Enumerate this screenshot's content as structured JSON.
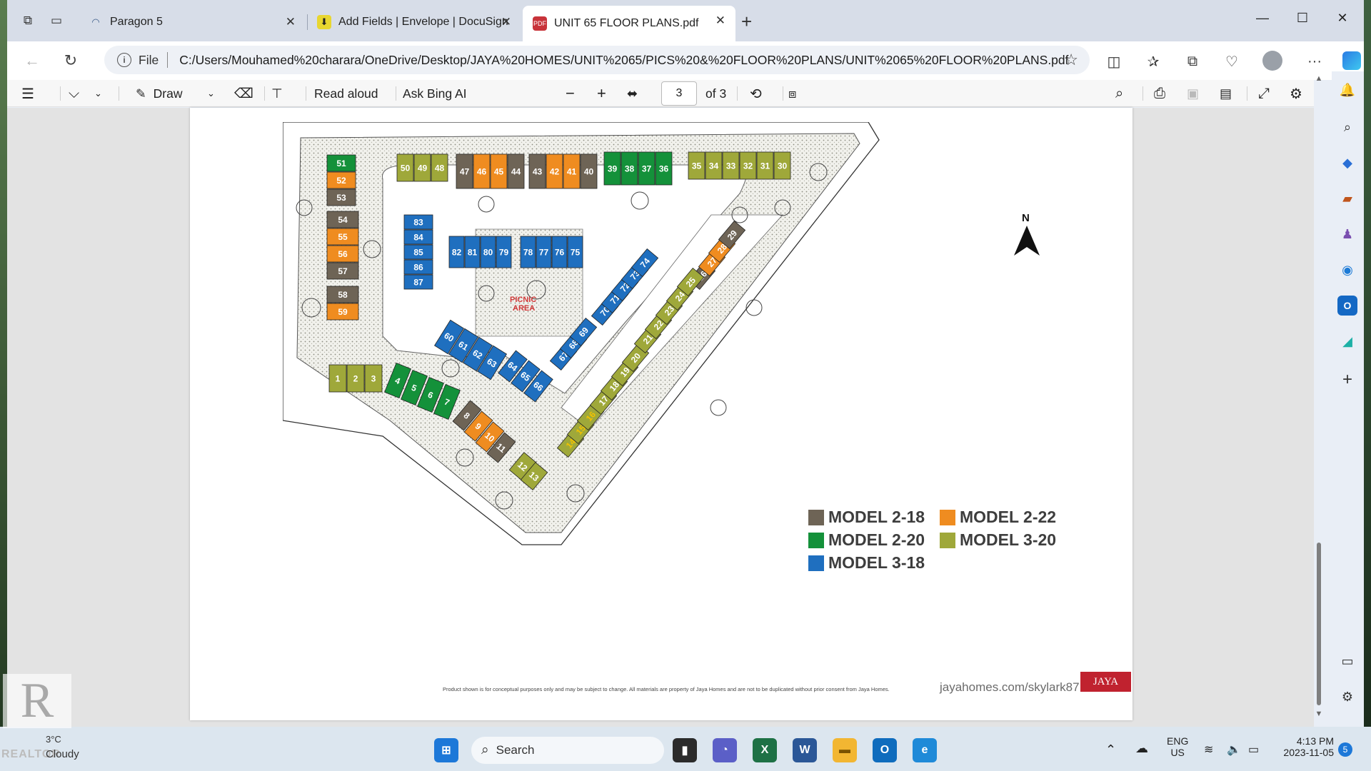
{
  "tabs": [
    {
      "title": "Paragon 5"
    },
    {
      "title": "Add Fields | Envelope | DocuSign"
    },
    {
      "title": "UNIT 65 FLOOR PLANS.pdf"
    }
  ],
  "address": {
    "scheme": "File",
    "url": "C:/Users/Mouhamed%20charara/OneDrive/Desktop/JAYA%20HOMES/UNIT%2065/PICS%20&%20FLOOR%20PLANS/UNIT%2065%20FLOOR%20PLANS.pdf"
  },
  "pdf_toolbar": {
    "draw_label": "Draw",
    "read_aloud_label": "Read aloud",
    "ask_bing_label": "Ask Bing AI",
    "page_current": "3",
    "page_total": "of 3"
  },
  "plan": {
    "picnic_label_1": "PICNIC",
    "picnic_label_2": "AREA",
    "north_label": "N",
    "colors": {
      "model_2_18": "#6e6456",
      "model_2_22": "#ef8c20",
      "model_2_20": "#14913a",
      "model_3_20": "#9fa83a",
      "model_3_18": "#1f6fbf"
    },
    "units": [
      {
        "n": "1",
        "m": "model_3_20"
      },
      {
        "n": "2",
        "m": "model_3_20"
      },
      {
        "n": "3",
        "m": "model_3_20"
      },
      {
        "n": "4",
        "m": "model_2_20"
      },
      {
        "n": "5",
        "m": "model_2_20"
      },
      {
        "n": "6",
        "m": "model_2_20"
      },
      {
        "n": "7",
        "m": "model_2_20"
      },
      {
        "n": "8",
        "m": "model_2_18"
      },
      {
        "n": "9",
        "m": "model_2_22"
      },
      {
        "n": "10",
        "m": "model_2_22"
      },
      {
        "n": "11",
        "m": "model_2_18"
      },
      {
        "n": "12",
        "m": "model_3_20"
      },
      {
        "n": "13",
        "m": "model_3_20"
      },
      {
        "n": "14",
        "m": "model_3_20"
      },
      {
        "n": "15",
        "m": "model_3_20"
      },
      {
        "n": "16",
        "m": "model_3_20"
      },
      {
        "n": "17",
        "m": "model_3_20"
      },
      {
        "n": "18",
        "m": "model_3_20"
      },
      {
        "n": "19",
        "m": "model_3_20"
      },
      {
        "n": "20",
        "m": "model_3_20"
      },
      {
        "n": "21",
        "m": "model_3_20"
      },
      {
        "n": "22",
        "m": "model_3_20"
      },
      {
        "n": "23",
        "m": "model_3_20"
      },
      {
        "n": "24",
        "m": "model_3_20"
      },
      {
        "n": "25",
        "m": "model_3_20"
      },
      {
        "n": "26",
        "m": "model_2_18"
      },
      {
        "n": "27",
        "m": "model_2_22"
      },
      {
        "n": "28",
        "m": "model_2_22"
      },
      {
        "n": "29",
        "m": "model_2_18"
      },
      {
        "n": "30",
        "m": "model_3_20"
      },
      {
        "n": "31",
        "m": "model_3_20"
      },
      {
        "n": "32",
        "m": "model_3_20"
      },
      {
        "n": "33",
        "m": "model_3_20"
      },
      {
        "n": "34",
        "m": "model_3_20"
      },
      {
        "n": "35",
        "m": "model_3_20"
      },
      {
        "n": "36",
        "m": "model_2_20"
      },
      {
        "n": "37",
        "m": "model_2_20"
      },
      {
        "n": "38",
        "m": "model_2_20"
      },
      {
        "n": "39",
        "m": "model_2_20"
      },
      {
        "n": "40",
        "m": "model_2_18"
      },
      {
        "n": "41",
        "m": "model_2_22"
      },
      {
        "n": "42",
        "m": "model_2_22"
      },
      {
        "n": "43",
        "m": "model_2_18"
      },
      {
        "n": "44",
        "m": "model_2_18"
      },
      {
        "n": "45",
        "m": "model_2_22"
      },
      {
        "n": "46",
        "m": "model_2_22"
      },
      {
        "n": "47",
        "m": "model_2_18"
      },
      {
        "n": "48",
        "m": "model_3_20"
      },
      {
        "n": "49",
        "m": "model_3_20"
      },
      {
        "n": "50",
        "m": "model_3_20"
      },
      {
        "n": "51",
        "m": "model_2_20"
      },
      {
        "n": "52",
        "m": "model_2_22"
      },
      {
        "n": "53",
        "m": "model_2_18"
      },
      {
        "n": "54",
        "m": "model_2_18"
      },
      {
        "n": "55",
        "m": "model_2_22"
      },
      {
        "n": "56",
        "m": "model_2_22"
      },
      {
        "n": "57",
        "m": "model_2_18"
      },
      {
        "n": "58",
        "m": "model_2_18"
      },
      {
        "n": "59",
        "m": "model_2_22"
      },
      {
        "n": "60",
        "m": "model_3_18"
      },
      {
        "n": "61",
        "m": "model_3_18"
      },
      {
        "n": "62",
        "m": "model_3_18"
      },
      {
        "n": "63",
        "m": "model_3_18"
      },
      {
        "n": "64",
        "m": "model_3_18"
      },
      {
        "n": "65",
        "m": "model_3_18"
      },
      {
        "n": "66",
        "m": "model_3_18"
      },
      {
        "n": "67",
        "m": "model_3_18"
      },
      {
        "n": "68",
        "m": "model_3_18"
      },
      {
        "n": "69",
        "m": "model_3_18"
      },
      {
        "n": "70",
        "m": "model_3_18"
      },
      {
        "n": "71",
        "m": "model_3_18"
      },
      {
        "n": "72",
        "m": "model_3_18"
      },
      {
        "n": "73",
        "m": "model_3_18"
      },
      {
        "n": "74",
        "m": "model_3_18"
      },
      {
        "n": "75",
        "m": "model_3_18"
      },
      {
        "n": "76",
        "m": "model_3_18"
      },
      {
        "n": "77",
        "m": "model_3_18"
      },
      {
        "n": "78",
        "m": "model_3_18"
      },
      {
        "n": "79",
        "m": "model_3_18"
      },
      {
        "n": "80",
        "m": "model_3_18"
      },
      {
        "n": "81",
        "m": "model_3_18"
      },
      {
        "n": "82",
        "m": "model_3_18"
      },
      {
        "n": "83",
        "m": "model_3_18"
      },
      {
        "n": "84",
        "m": "model_3_18"
      },
      {
        "n": "85",
        "m": "model_3_18"
      },
      {
        "n": "86",
        "m": "model_3_18"
      },
      {
        "n": "87",
        "m": "model_3_18"
      }
    ]
  },
  "legend": [
    {
      "label": "MODEL 2-18",
      "color": "#6e6456"
    },
    {
      "label": "MODEL 2-22",
      "color": "#ef8c20"
    },
    {
      "label": "MODEL 2-20",
      "color": "#14913a"
    },
    {
      "label": "MODEL 3-20",
      "color": "#9fa83a"
    },
    {
      "label": "MODEL 3-18",
      "color": "#1f6fbf"
    }
  ],
  "footer": {
    "disclaimer": "Product shown is for conceptual purposes only and may be subject to change. All materials are property of Jaya Homes and are not to be duplicated without prior consent from Jaya Homes.",
    "website": "jayahomes.com/skylark87",
    "brand": "JAYA"
  },
  "taskbar": {
    "weather_temp": "3°C",
    "weather_desc": "Cloudy",
    "watermark": "REALTOR",
    "search_label": "Search",
    "lang_1": "ENG",
    "lang_2": "US",
    "time": "4:13 PM",
    "date": "2023-11-05",
    "notifications": "5"
  }
}
